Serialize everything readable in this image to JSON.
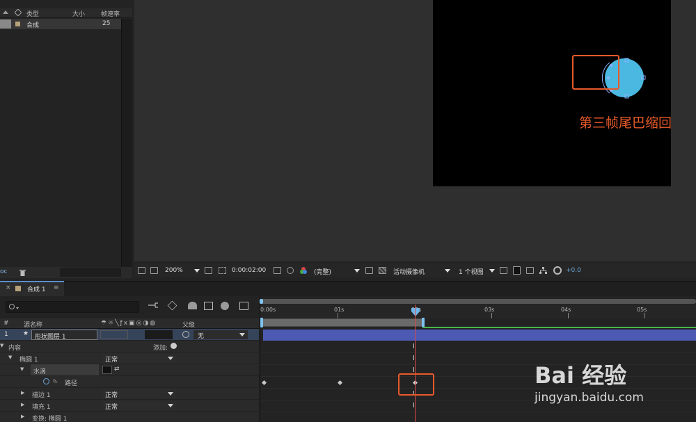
{
  "project": {
    "columns": {
      "type": "类型",
      "size": "大小",
      "fps": "帧速率"
    },
    "rows": [
      {
        "type": "合成",
        "fps": "25"
      }
    ],
    "footer_label": "oc"
  },
  "viewer": {
    "annotation": "第三帧尾巴缩回",
    "toolbar": {
      "zoom": "200%",
      "timecode": "0:00:02:00",
      "resolution": "(完整)",
      "camera": "活动摄像机",
      "views": "1 个视图",
      "exposure": "+0.0"
    }
  },
  "timeline": {
    "tab_label": "合成 1",
    "search_placeholder": "",
    "columns": {
      "num": "#",
      "source_name": "源名称",
      "parent": "父级"
    },
    "layer": {
      "index": "1",
      "name": "形状图层 1",
      "parent": "无"
    },
    "contents_label": "内容",
    "add_label": "添加:",
    "ellipse_label": "椭圆 1",
    "ellipse_mode": "正常",
    "waterdrop_label": "水滴",
    "path_label": "路径",
    "stroke_label": "描边 1",
    "stroke_mode": "正常",
    "fill_label": "填充 1",
    "fill_mode": "正常",
    "transform_label": "变换: 椭圆 1",
    "ruler": [
      "0:00s",
      "01s",
      "02s",
      "03s",
      "04s",
      "05s"
    ]
  },
  "watermark": {
    "brand": "Bai 经验",
    "url": "jingyan.baidu.com"
  },
  "colors": {
    "accent_blue": "#5b8ec9",
    "highlight_orange": "#e85a2a",
    "layer_bar": "#4d5ab4",
    "circle_fill": "#4ab8e0",
    "playhead": "#e04848"
  }
}
